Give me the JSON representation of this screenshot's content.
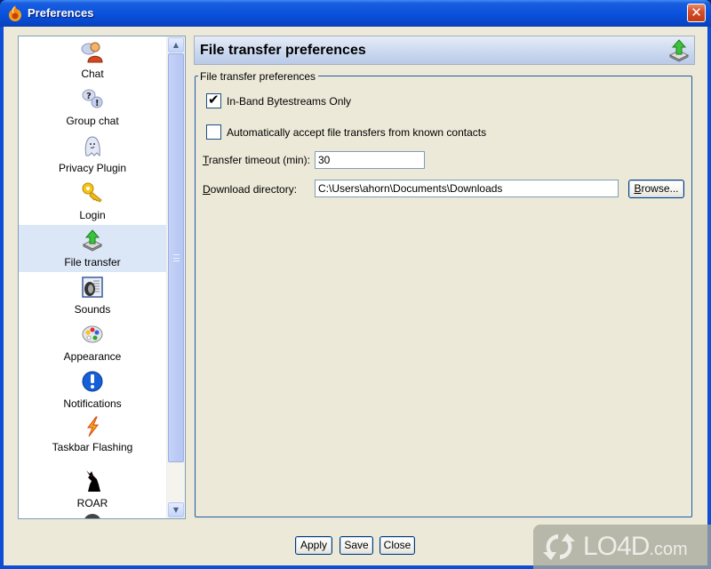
{
  "window": {
    "title": "Preferences",
    "close_glyph": "✕",
    "app_icon": "flame-icon"
  },
  "sidebar": {
    "selected_index": 4,
    "items": [
      {
        "label": "Chat",
        "icon": "chat-user-icon"
      },
      {
        "label": "Group chat",
        "icon": "group-chat-bubbles-icon"
      },
      {
        "label": "Privacy Plugin",
        "icon": "ghost-icon"
      },
      {
        "label": "Login",
        "icon": "key-icon"
      },
      {
        "label": "File transfer",
        "icon": "upload-arrow-tray-icon"
      },
      {
        "label": "Sounds",
        "icon": "speaker-document-icon"
      },
      {
        "label": "Appearance",
        "icon": "palette-icon"
      },
      {
        "label": "Notifications",
        "icon": "exclamation-circle-icon"
      },
      {
        "label": "Taskbar Flashing",
        "icon": "lightning-icon"
      },
      {
        "label": "ROAR",
        "icon": "wolf-icon"
      }
    ],
    "scroll_up_glyph": "▲",
    "scroll_down_glyph": "▼"
  },
  "header": {
    "title": "File transfer preferences",
    "icon": "upload-arrow-tray-icon"
  },
  "group": {
    "legend": "File transfer preferences",
    "checkboxes": [
      {
        "label": "In-Band Bytestreams Only",
        "checked": true,
        "check_glyph": "✔"
      },
      {
        "label": "Automatically accept file transfers from known contacts",
        "checked": false
      }
    ],
    "timeout": {
      "label_mnemonic": "T",
      "label_rest": "ransfer timeout (min):",
      "value": "30"
    },
    "download": {
      "label_mnemonic": "D",
      "label_rest": "ownload directory:",
      "value": "C:\\Users\\ahorn\\Documents\\Downloads"
    },
    "browse": {
      "mnemonic": "B",
      "rest": "rowse..."
    }
  },
  "footer": {
    "apply": "Apply",
    "save": "Save",
    "close": "Close"
  },
  "watermark": {
    "text": "LO4D",
    "suffix": ".com"
  }
}
